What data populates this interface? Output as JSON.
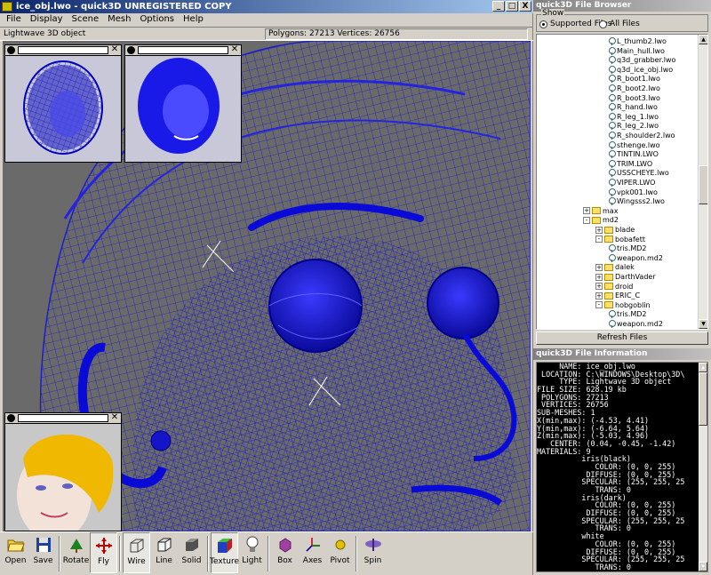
{
  "window": {
    "title": "ice_obj.lwo - quick3D UNREGISTERED COPY",
    "min": "_",
    "max": "□",
    "close": "X"
  },
  "menu": [
    "File",
    "Display",
    "Scene",
    "Mesh",
    "Options",
    "Help"
  ],
  "info_bar": {
    "object_type": "Lightwave 3D object",
    "stats": "Polygons: 27213  Vertices: 26756"
  },
  "toolbar": [
    {
      "label": "Open",
      "icon": "open-folder-icon",
      "active": false
    },
    {
      "label": "Save",
      "icon": "floppy-disk-icon",
      "active": false
    },
    {
      "sep": true
    },
    {
      "label": "Rotate",
      "icon": "rotate-tree-icon",
      "active": false
    },
    {
      "label": "Fly",
      "icon": "fly-arrows-icon",
      "active": true
    },
    {
      "sep": true
    },
    {
      "label": "Wire",
      "icon": "wire-cube-icon",
      "active": true
    },
    {
      "label": "Line",
      "icon": "line-cube-icon",
      "active": false
    },
    {
      "label": "Solid",
      "icon": "solid-cube-icon",
      "active": false
    },
    {
      "sep": true
    },
    {
      "label": "Texture",
      "icon": "texture-cube-icon",
      "active": true
    },
    {
      "label": "Light",
      "icon": "light-bulb-icon",
      "active": false
    },
    {
      "sep": true
    },
    {
      "label": "Box",
      "icon": "bounding-box-icon",
      "active": false
    },
    {
      "label": "Axes",
      "icon": "axes-icon",
      "active": false
    },
    {
      "label": "Pivot",
      "icon": "pivot-dot-icon",
      "active": false
    },
    {
      "sep": true
    },
    {
      "label": "Spin",
      "icon": "spin-top-icon",
      "active": false
    }
  ],
  "browser": {
    "title": "quick3D File Browser",
    "show_label": "Show",
    "radio_supported": "Supported Files",
    "radio_all": "All Files",
    "refresh": "Refresh Files",
    "tree": [
      {
        "label": "L_thumb2.lwo",
        "type": "file",
        "level": 3
      },
      {
        "label": "Main_hull.lwo",
        "type": "file",
        "level": 3
      },
      {
        "label": "q3d_grabber.lwo",
        "type": "file",
        "level": 3
      },
      {
        "label": "q3d_ice_obj.lwo",
        "type": "file",
        "level": 3
      },
      {
        "label": "R_boot1.lwo",
        "type": "file",
        "level": 3
      },
      {
        "label": "R_boot2.lwo",
        "type": "file",
        "level": 3
      },
      {
        "label": "R_boot3.lwo",
        "type": "file",
        "level": 3
      },
      {
        "label": "R_hand.lwo",
        "type": "file",
        "level": 3
      },
      {
        "label": "R_leg_1.lwo",
        "type": "file",
        "level": 3
      },
      {
        "label": "R_leg_2.lwo",
        "type": "file",
        "level": 3
      },
      {
        "label": "R_shoulder2.lwo",
        "type": "file",
        "level": 3
      },
      {
        "label": "sthenge.lwo",
        "type": "file",
        "level": 3
      },
      {
        "label": "TINTIN.LWO",
        "type": "file",
        "level": 3
      },
      {
        "label": "TRIM.LWO",
        "type": "file",
        "level": 3
      },
      {
        "label": "USSCHEYE.lwo",
        "type": "file",
        "level": 3
      },
      {
        "label": "VIPER.LWO",
        "type": "file",
        "level": 3
      },
      {
        "label": "vpk001.lwo",
        "type": "file",
        "level": 3
      },
      {
        "label": "Wingsss2.lwo",
        "type": "file",
        "level": 3
      },
      {
        "label": "max",
        "type": "folder",
        "level": 1,
        "exp": "+"
      },
      {
        "label": "md2",
        "type": "folder",
        "level": 1,
        "exp": "-"
      },
      {
        "label": "blade",
        "type": "folder",
        "level": 2,
        "exp": "+"
      },
      {
        "label": "bobafett",
        "type": "folder",
        "level": 2,
        "exp": "-"
      },
      {
        "label": "tris.MD2",
        "type": "file",
        "level": 3
      },
      {
        "label": "weapon.md2",
        "type": "file",
        "level": 3
      },
      {
        "label": "dalek",
        "type": "folder",
        "level": 2,
        "exp": "+"
      },
      {
        "label": "DarthVader",
        "type": "folder",
        "level": 2,
        "exp": "+"
      },
      {
        "label": "droid",
        "type": "folder",
        "level": 2,
        "exp": "+"
      },
      {
        "label": "ERIC_C",
        "type": "folder",
        "level": 2,
        "exp": "+"
      },
      {
        "label": "hobgoblin",
        "type": "folder",
        "level": 2,
        "exp": "-"
      },
      {
        "label": "tris.MD2",
        "type": "file",
        "level": 3
      },
      {
        "label": "weapon.md2",
        "type": "file",
        "level": 3
      }
    ]
  },
  "file_info": {
    "title": "quick3D File Information",
    "lines": [
      "     NAME: ice_obj.lwo",
      " LOCATION: C:\\WINDOWS\\Desktop\\3D\\",
      "     TYPE: Lightwave 3D object",
      "FILE SIZE: 628.19 kb",
      " POLYGONS: 27213",
      " VERTICES: 26756",
      "SUB-MESHES: 1",
      "X(min,max): (-4.53, 4.41)",
      "Y(min,max): (-6.64, 5.64)",
      "Z(min,max): (-5.03, 4.96)",
      "   CENTER: (0.04, -0.45, -1.42)",
      "MATERIALS: 9",
      "          iris(black)",
      "             COLOR: (0, 0, 255)",
      "           DIFFUSE: (0, 0, 255)",
      "          SPECULAR: (255, 255, 25",
      "             TRANS: 0",
      "          iris(dark)",
      "             COLOR: (0, 0, 255)",
      "           DIFFUSE: (0, 0, 255)",
      "          SPECULAR: (255, 255, 25",
      "             TRANS: 0",
      "          white",
      "             COLOR: (0, 0, 255)",
      "           DIFFUSE: (0, 0, 255)",
      "          SPECULAR: (255, 255, 25",
      "             TRANS: 0"
    ]
  },
  "colors": {
    "wire": "#1a1acc",
    "viewport_bg": "#6a6a6a",
    "hair": "#f0b800",
    "title_blue": "#0a246a"
  }
}
